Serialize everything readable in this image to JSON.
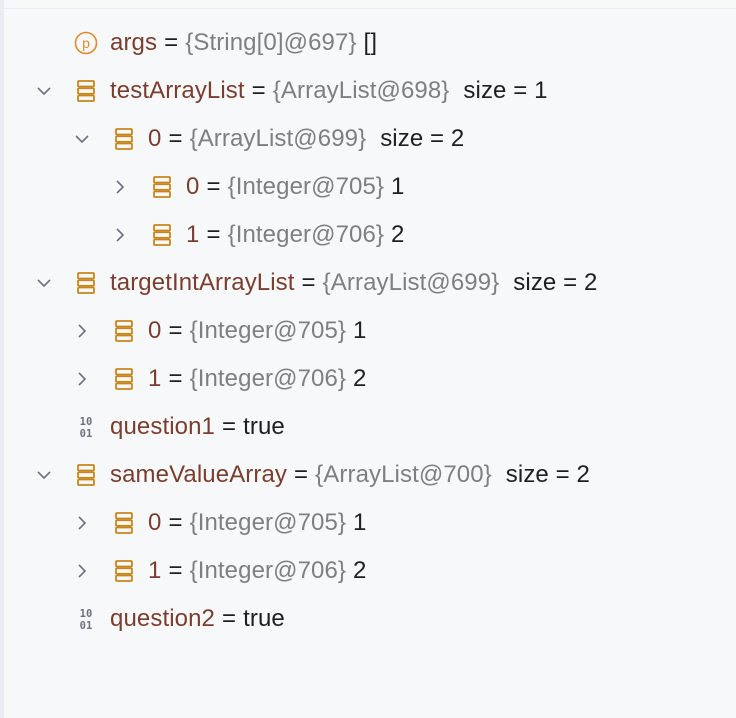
{
  "rows": [
    {
      "name": "args",
      "ref": "{String[0]@697}",
      "val": "[]",
      "icon": "param-icon",
      "chevron": "none"
    },
    {
      "name": "testArrayList",
      "ref": "{ArrayList@698}",
      "val": "size = 1",
      "icon": "list-icon",
      "chevron": "expanded"
    },
    {
      "name": "0",
      "ref": "{ArrayList@699}",
      "val": "size = 2",
      "icon": "list-icon",
      "chevron": "expanded"
    },
    {
      "name": "0",
      "ref": "{Integer@705}",
      "val": "1",
      "icon": "list-icon",
      "chevron": "collapsed"
    },
    {
      "name": "1",
      "ref": "{Integer@706}",
      "val": "2",
      "icon": "list-icon",
      "chevron": "collapsed"
    },
    {
      "name": "targetIntArrayList",
      "ref": "{ArrayList@699}",
      "val": "size = 2",
      "icon": "list-icon",
      "chevron": "expanded"
    },
    {
      "name": "0",
      "ref": "{Integer@705}",
      "val": "1",
      "icon": "list-icon",
      "chevron": "collapsed"
    },
    {
      "name": "1",
      "ref": "{Integer@706}",
      "val": "2",
      "icon": "list-icon",
      "chevron": "collapsed"
    },
    {
      "name": "question1",
      "ref": "",
      "val": "true",
      "icon": "binary-icon",
      "chevron": "none"
    },
    {
      "name": "sameValueArray",
      "ref": "{ArrayList@700}",
      "val": "size = 2",
      "icon": "list-icon",
      "chevron": "expanded"
    },
    {
      "name": "0",
      "ref": "{Integer@705}",
      "val": "1",
      "icon": "list-icon",
      "chevron": "collapsed"
    },
    {
      "name": "1",
      "ref": "{Integer@706}",
      "val": "2",
      "icon": "list-icon",
      "chevron": "collapsed"
    },
    {
      "name": "question2",
      "ref": "",
      "val": "true",
      "icon": "binary-icon",
      "chevron": "none"
    }
  ],
  "equals_sign": "=",
  "param_letter": "p",
  "binary_glyph_top": "10",
  "binary_glyph_bottom": "01",
  "colors": {
    "name": "#7a3e2e",
    "reference": "#7f7f7f",
    "value": "#1f1f1f",
    "icon_orange": "#c7861a",
    "chevron": "#6c707e",
    "background": "#f7f8fa"
  }
}
